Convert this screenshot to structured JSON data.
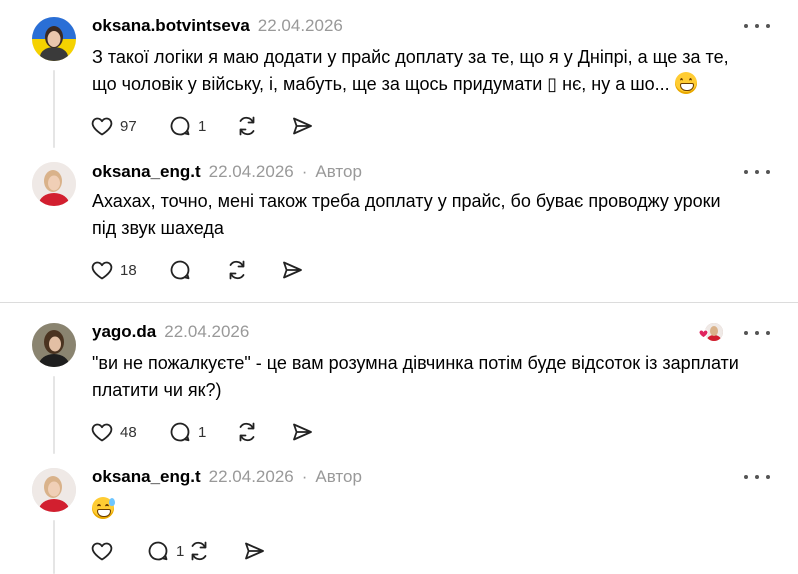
{
  "posts": [
    {
      "username": "oksana.botvintseva",
      "date": "22.04.2026",
      "author_tag": "",
      "text_line1": "З такої логіки я маю додати у прайс доплату за те, що я у Дніпрі, а ще за те,",
      "text_line2": "що чоловік у війську, і, мабуть, ще за щось придумати ▯ нє, ну а шо...",
      "likes": "97",
      "replies": "1",
      "avatar_icon": "avatar-ukraine-flag"
    },
    {
      "username": "oksana_eng.t",
      "date": "22.04.2026",
      "separator": "·",
      "author_tag": "Автор",
      "text_line1": "Ахахах, точно, мені також треба доплату у прайс, бо буває проводжу уроки",
      "text_line2": "під звук шахеда",
      "likes": "18",
      "replies": "",
      "avatar_icon": "avatar-woman-red"
    },
    {
      "username": "yago.da",
      "date": "22.04.2026",
      "author_tag": "",
      "text_line1": "\"ви не пожалкуєте\" - це вам розумна дівчинка потім буде відсоток із зарплати",
      "text_line2": "платити чи як?)",
      "likes": "48",
      "replies": "1",
      "avatar_icon": "avatar-woman-dark"
    },
    {
      "username": "oksana_eng.t",
      "date": "22.04.2026",
      "separator": "·",
      "author_tag": "Автор",
      "likes": "",
      "replies": "1",
      "avatar_icon": "avatar-woman-red"
    }
  ],
  "colors": {
    "text": "#000000",
    "muted": "#999999",
    "divider": "#dcdcdc",
    "thread_line": "#e5e5e5",
    "heart_badge": "#e0245e"
  },
  "icons": [
    "heart-icon",
    "comment-icon",
    "repost-icon",
    "share-icon",
    "more-icon",
    "grinning-emoji",
    "sweat-smile-emoji"
  ]
}
